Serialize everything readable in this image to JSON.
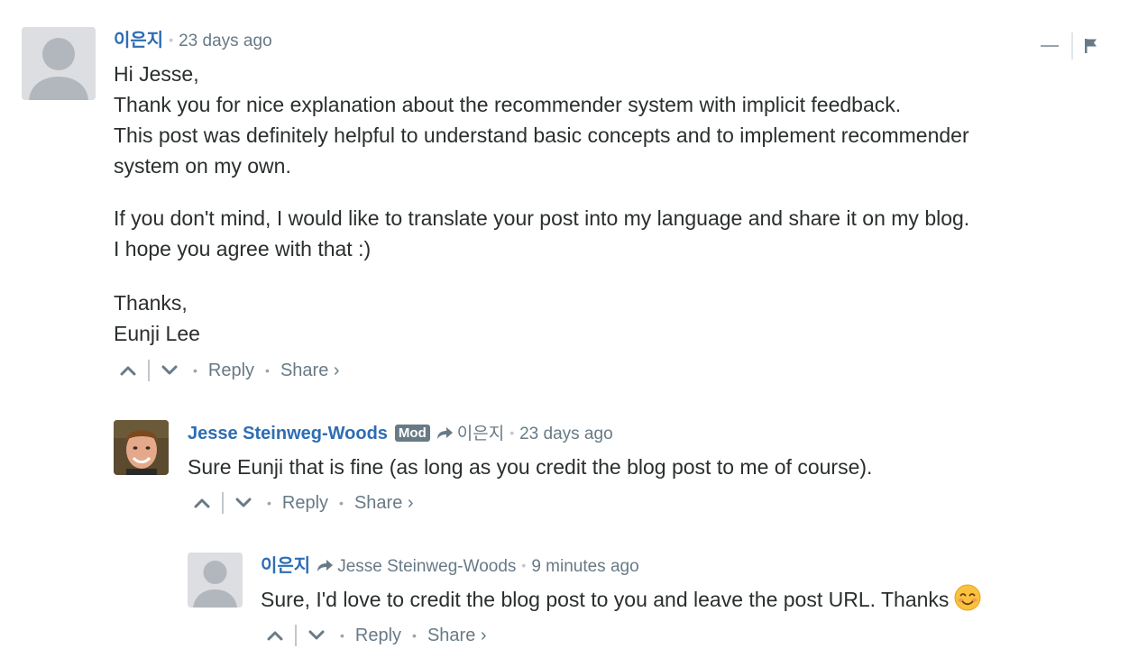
{
  "comments": [
    {
      "author": "이은지",
      "timestamp": "23 days ago",
      "paragraphs": [
        [
          "Hi Jesse,",
          "Thank you for nice explanation about the recommender system with implicit feedback.",
          "This post was definitely helpful to understand basic concepts and to implement recommender",
          "system on my own."
        ],
        [
          "If you don't mind, I would like to translate your post into my language and share it on my blog.",
          "I hope you agree with that :)"
        ],
        [
          "Thanks,",
          "Eunji Lee"
        ]
      ],
      "reply_label": "Reply",
      "share_label": "Share ›"
    },
    {
      "author": "Jesse Steinweg-Woods",
      "badge": "Mod",
      "reply_to": "이은지",
      "timestamp": "23 days ago",
      "text": "Sure Eunji that is fine (as long as you credit the blog post to me of course).",
      "reply_label": "Reply",
      "share_label": "Share ›"
    },
    {
      "author": "이은지",
      "reply_to": "Jesse Steinweg-Woods",
      "timestamp": "9 minutes ago",
      "text": "Sure, I'd love to credit the blog post to you and leave the post URL. Thanks",
      "emoji": "smiling-face-emoji",
      "reply_label": "Reply",
      "share_label": "Share ›"
    }
  ],
  "colors": {
    "author": "#2e6db4",
    "meta": "#687a86",
    "body": "#2a2e2e",
    "divider": "#c2c6cc",
    "badge_bg": "#687a86"
  },
  "icons": [
    "default-avatar-icon",
    "user-photo-avatar",
    "upvote-icon",
    "downvote-icon",
    "reply-arrow-icon",
    "collapse-icon",
    "flag-icon"
  ]
}
